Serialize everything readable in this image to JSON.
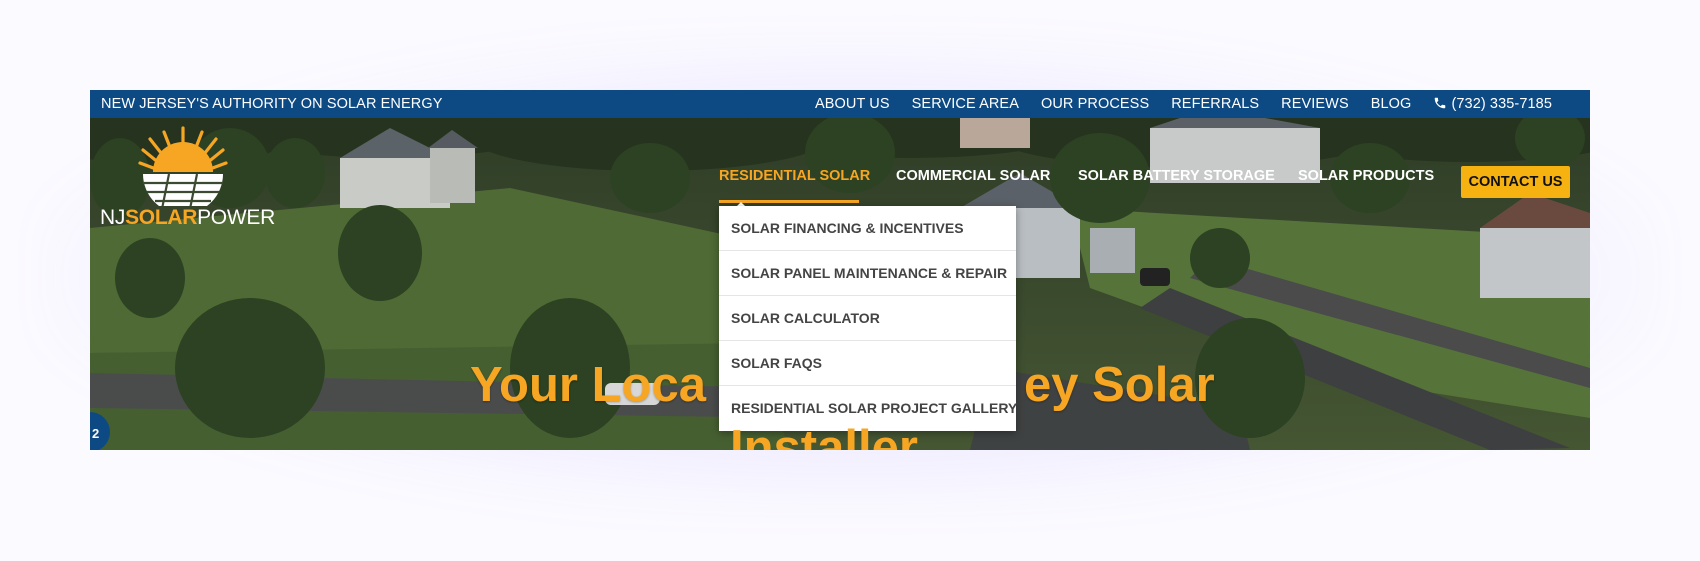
{
  "topbar": {
    "tagline": "NEW JERSEY'S AUTHORITY ON SOLAR ENERGY",
    "links": [
      "ABOUT US",
      "SERVICE AREA",
      "OUR PROCESS",
      "REFERRALS",
      "REVIEWS",
      "BLOG"
    ],
    "phone": "(732) 335-7185"
  },
  "logo": {
    "nj": "NJ",
    "solar": "SOLAR",
    "power": "POWER"
  },
  "nav": {
    "items": [
      "RESIDENTIAL SOLAR",
      "COMMERCIAL SOLAR",
      "SOLAR BATTERY STORAGE",
      "SOLAR PRODUCTS"
    ],
    "contact_label": "CONTACT US"
  },
  "dropdown": {
    "items": [
      "SOLAR FINANCING & INCENTIVES",
      "SOLAR PANEL MAINTENANCE & REPAIR",
      "SOLAR CALCULATOR",
      "SOLAR FAQS",
      "RESIDENTIAL SOLAR PROJECT GALLERY"
    ]
  },
  "hero": {
    "headline_left": "Your Loca",
    "headline_right": "ey Solar",
    "headline_line2": "Installer"
  },
  "chat": {
    "label": "2"
  },
  "colors": {
    "brand_blue": "#0d4a84",
    "accent_orange": "#f6a623",
    "button_yellow": "#f6b211"
  }
}
